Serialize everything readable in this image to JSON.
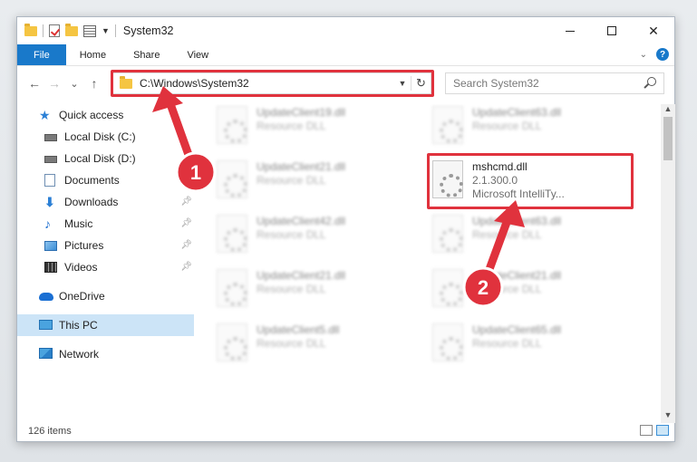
{
  "window": {
    "title": "System32",
    "controls": {
      "minimize": "—",
      "maximize": "☐",
      "close": "✕"
    }
  },
  "ribbon": {
    "tabs": [
      {
        "label": "File"
      },
      {
        "label": "Home"
      },
      {
        "label": "Share"
      },
      {
        "label": "View"
      }
    ],
    "help": "?"
  },
  "nav": {
    "back": "←",
    "forward": "→",
    "recent": "⌄",
    "up": "↑",
    "address": "C:\\Windows\\System32",
    "search_placeholder": "Search System32"
  },
  "sidebar": {
    "items": [
      {
        "label": "Quick access",
        "icon": "star-icon"
      },
      {
        "label": "Local Disk (C:)",
        "icon": "drive-icon"
      },
      {
        "label": "Local Disk (D:)",
        "icon": "drive-icon"
      },
      {
        "label": "Documents",
        "icon": "documents-icon",
        "pinned": true
      },
      {
        "label": "Downloads",
        "icon": "downloads-icon",
        "pinned": true
      },
      {
        "label": "Music",
        "icon": "music-icon",
        "pinned": true
      },
      {
        "label": "Pictures",
        "icon": "pictures-icon",
        "pinned": true
      },
      {
        "label": "Videos",
        "icon": "videos-icon",
        "pinned": true
      },
      {
        "label": "OneDrive",
        "icon": "onedrive-icon"
      },
      {
        "label": "This PC",
        "icon": "this-pc-icon",
        "selected": true
      },
      {
        "label": "Network",
        "icon": "network-icon"
      }
    ]
  },
  "files": {
    "left": [
      {
        "name": "UpdateClient19.dll",
        "type": "Resource DLL"
      },
      {
        "name": "UpdateClient21.dll",
        "type": "Resource DLL"
      },
      {
        "name": "UpdateClient42.dll",
        "type": "Resource DLL"
      },
      {
        "name": "UpdateClient21.dll",
        "type": "Resource DLL"
      },
      {
        "name": "UpdateClient5.dll",
        "type": "Resource DLL"
      }
    ],
    "right": [
      {
        "name": "UpdateClient63.dll",
        "type": "Resource DLL"
      },
      {
        "name": "mshcmd.dll",
        "version": "2.1.300.0",
        "description": "Microsoft IntelliTy..."
      },
      {
        "name": "UpdateClient63.dll",
        "type": "Resource DLL"
      },
      {
        "name": "UpdateClient21.dll",
        "type": "Resource DLL"
      },
      {
        "name": "UpdateClient65.dll",
        "type": "Resource DLL"
      }
    ]
  },
  "status": {
    "item_count": "126 items"
  },
  "annotations": {
    "step1": "1",
    "step2": "2",
    "color": "#e0323d"
  }
}
